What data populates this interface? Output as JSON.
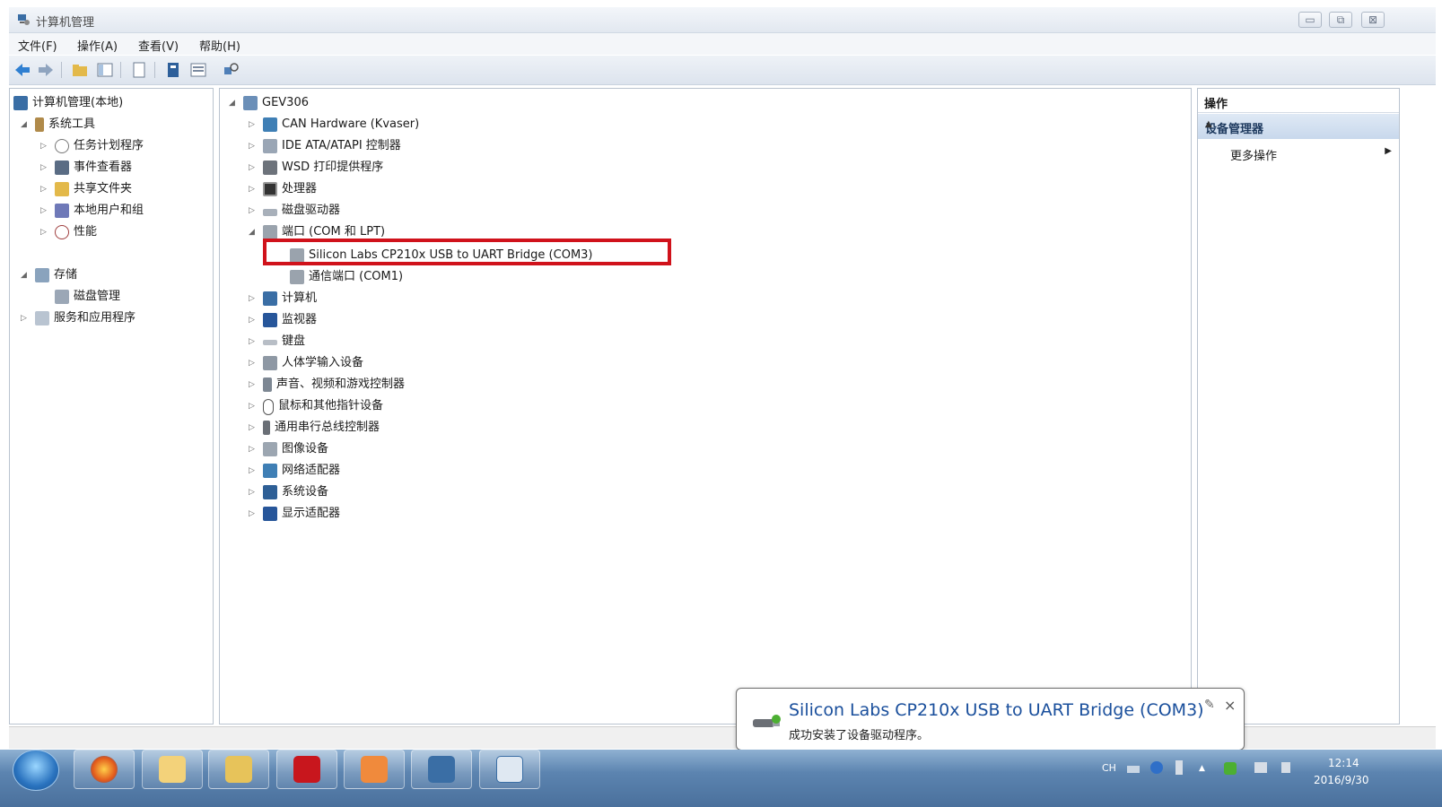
{
  "window": {
    "title": "计算机管理",
    "controls": {
      "minimize": "▭",
      "maximize": "⧉",
      "close": "⊠"
    }
  },
  "menu": [
    "文件(F)",
    "操作(A)",
    "查看(V)",
    "帮助(H)"
  ],
  "left_tree": {
    "root": "计算机管理(本地)",
    "system_tools": "系统工具",
    "system_children": [
      "任务计划程序",
      "事件查看器",
      "共享文件夹",
      "本地用户和组",
      "性能"
    ],
    "storage": "存储",
    "storage_children": [
      "磁盘管理"
    ],
    "services": "服务和应用程序"
  },
  "device_tree": {
    "computer": "GEV306",
    "categories_before": [
      "CAN Hardware (Kvaser)",
      "IDE ATA/ATAPI 控制器",
      "WSD 打印提供程序",
      "处理器",
      "磁盘驱动器"
    ],
    "ports": {
      "label": "端口 (COM 和 LPT)",
      "children": [
        "Silicon Labs CP210x USB to UART Bridge (COM3)",
        "通信端口 (COM1)"
      ]
    },
    "categories_after": [
      "计算机",
      "监视器",
      "键盘",
      "人体学输入设备",
      "声音、视频和游戏控制器",
      "鼠标和其他指针设备",
      "通用串行总线控制器",
      "图像设备",
      "网络适配器",
      "系统设备",
      "显示适配器"
    ]
  },
  "actions": {
    "header": "操作",
    "section": "设备管理器",
    "more": "更多操作"
  },
  "notification": {
    "title": "Silicon Labs CP210x USB to UART Bridge (COM3)",
    "body": "成功安装了设备驱动程序。",
    "pin": "✎",
    "close": "×"
  },
  "tray": {
    "lang": "CH",
    "time": "12:14",
    "date": "2016/9/30"
  },
  "colors": {
    "highlight": "#d0121b",
    "notification_title": "#1a4f9c",
    "taskbar": "#5c84b0"
  }
}
